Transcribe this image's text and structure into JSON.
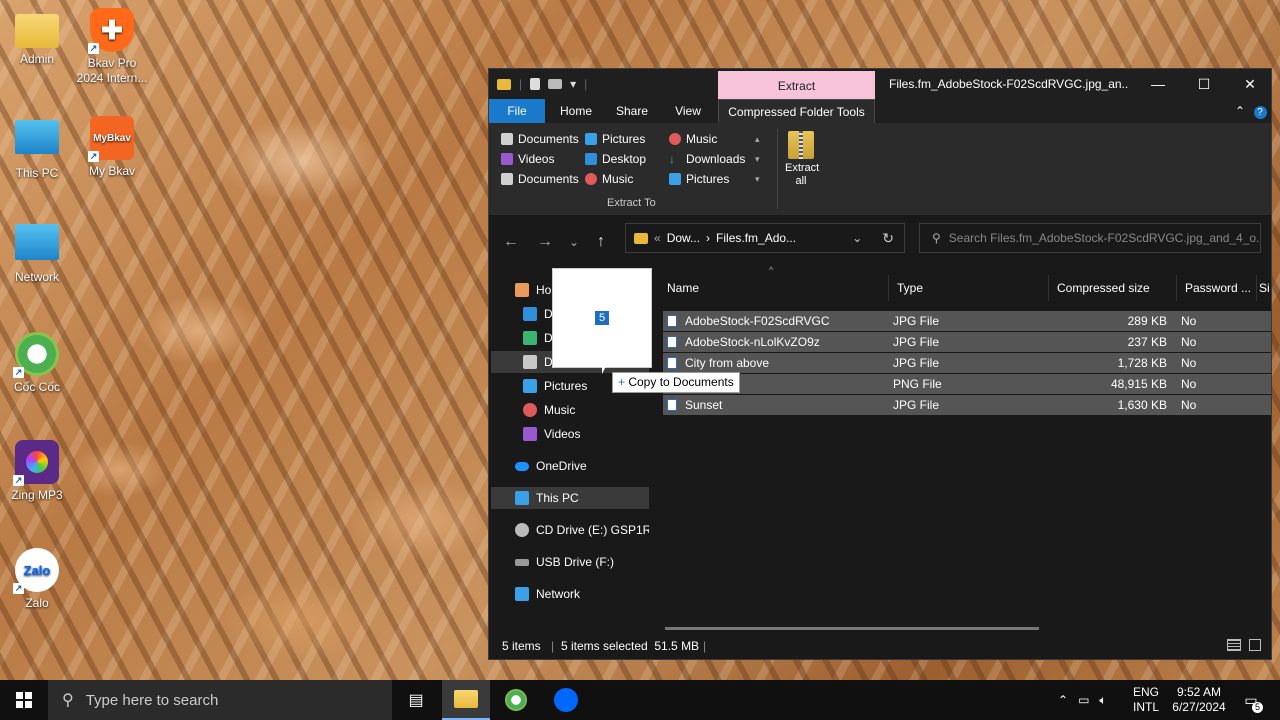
{
  "desktop": {
    "icons": [
      {
        "label": "Admin"
      },
      {
        "label": "Bkav Pro 2024 Intern..."
      },
      {
        "label": "This PC"
      },
      {
        "label": "My Bkav",
        "badge": "MyBkav"
      },
      {
        "label": "Network"
      },
      {
        "label": "Cốc Cốc"
      },
      {
        "label": "Zing MP3"
      },
      {
        "label": "Zalo",
        "badge": "Zalo"
      }
    ]
  },
  "window": {
    "context_header": "Extract",
    "title": "Files.fm_AdobeStock-F02ScdRVGC.jpg_an...",
    "controls": {
      "minimize": "—",
      "maximize": "☐",
      "close": "✕"
    },
    "tabs": [
      "File",
      "Home",
      "Share",
      "View",
      "Compressed Folder Tools"
    ],
    "ribbon": {
      "extract_to_items": [
        "Documents",
        "Pictures",
        "Music",
        "Videos",
        "Desktop",
        "Downloads",
        "Documents",
        "Music",
        "Pictures"
      ],
      "group_label": "Extract To",
      "extract_all": "Extract all"
    },
    "address": {
      "part1": "Dow...",
      "part2": "Files.fm_Ado..."
    },
    "search_placeholder": "Search Files.fm_AdobeStock-F02ScdRVGC.jpg_and_4_o...",
    "nav_pane": {
      "items": [
        {
          "label": "Ho"
        },
        {
          "label": "D"
        },
        {
          "label": "D"
        },
        {
          "label": "D"
        },
        {
          "label": "Pictures"
        },
        {
          "label": "Music"
        },
        {
          "label": "Videos"
        },
        {
          "label": "OneDrive"
        },
        {
          "label": "This PC"
        },
        {
          "label": "CD Drive (E:) GSP1RM"
        },
        {
          "label": "USB Drive (F:)"
        },
        {
          "label": "Network"
        }
      ]
    },
    "columns": [
      "Name",
      "Type",
      "Compressed size",
      "Password ...",
      "Si"
    ],
    "files": [
      {
        "name": "AdobeStock-F02ScdRVGC",
        "type": "JPG File",
        "size": "289 KB",
        "password": "No"
      },
      {
        "name": "AdobeStock-nLolKvZO9z",
        "type": "JPG File",
        "size": "237 KB",
        "password": "No"
      },
      {
        "name": "City from above",
        "type": "JPG File",
        "size": "1,728 KB",
        "password": "No"
      },
      {
        "name": "",
        "type": "PNG File",
        "size": "48,915 KB",
        "password": "No"
      },
      {
        "name": "Sunset",
        "type": "JPG File",
        "size": "1,630 KB",
        "password": "No"
      }
    ],
    "status": {
      "items": "5 items",
      "selected": "5 items selected  51.5 MB"
    },
    "drag": {
      "count": "5",
      "tooltip": "Copy to Documents"
    }
  },
  "taskbar": {
    "search_placeholder": "Type here to search",
    "lang": "ENG",
    "layout": "INTL",
    "time": "9:52 AM",
    "date": "6/27/2024",
    "notification_count": "5"
  }
}
